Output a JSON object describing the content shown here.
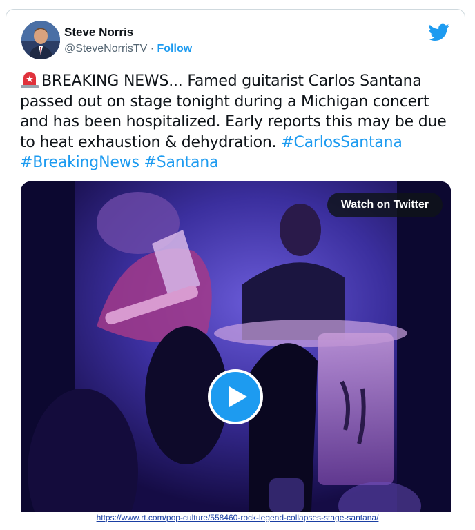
{
  "user": {
    "name": "Steve Norris",
    "handle": "@SteveNorrisTV",
    "separator": "·",
    "follow_label": "Follow",
    "avatar_icon": "profile-photo"
  },
  "tweet": {
    "emoji_icon": "police-siren-icon",
    "line1": "BREAKING NEWS... Famed guitarist Carlos Santana",
    "line2": "passed out on stage tonight during a Michigan concert",
    "line3": "and has been hospitalized. Early reports this may be due",
    "line4": "to heat exhaustion & dehydration.",
    "hashtag1": "#CarlosSantana",
    "hashtag2": "#BreakingNews",
    "hashtag3": "#Santana"
  },
  "media": {
    "watch_label": "Watch on Twitter",
    "play_icon": "play-icon"
  },
  "brand": {
    "twitter_blue": "#1d9bf0",
    "text_color": "#0f1419",
    "secondary_text": "#536471"
  },
  "source_url": "https://www.rt.com/pop-culture/558460-rock-legend-collapses-stage-santana/"
}
